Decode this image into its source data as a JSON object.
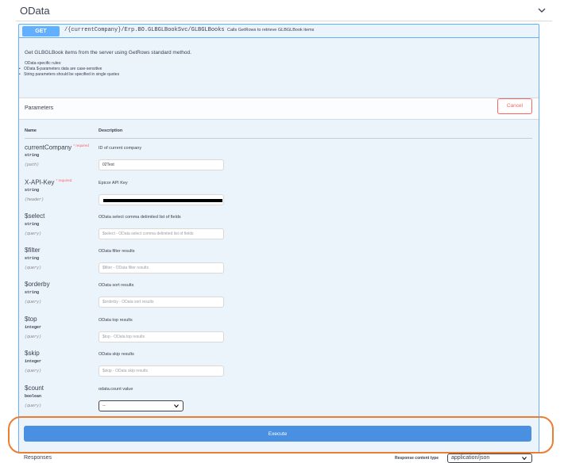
{
  "section": {
    "title": "OData"
  },
  "operation": {
    "method": "GET",
    "path": "/{currentCompany}/Erp.BO.GLBGLBookSvc/GLBGLBooks",
    "summary": "Calls GetRows to retrieve GLBGLBook items",
    "description": "Get GLBGLBook items from the server using GetRows standard method.",
    "rules_heading": "OData-specific rules:",
    "rules": [
      "OData $-parameters data are case-sensitive",
      "String parameters should be specified in single quotes"
    ]
  },
  "parameters": {
    "title": "Parameters",
    "cancel_label": "Cancel",
    "col_name": "Name",
    "col_description": "Description",
    "required_label": "* required",
    "items": [
      {
        "name": "currentCompany",
        "required": true,
        "type": "string",
        "in": "(path)",
        "description": "ID of current company",
        "value": "02Test",
        "placeholder": ""
      },
      {
        "name": "X-API-Key",
        "required": true,
        "type": "string",
        "in": "(header)",
        "description": "Epicor API Key",
        "value": "",
        "placeholder": "",
        "redacted": true
      },
      {
        "name": "$select",
        "required": false,
        "type": "string",
        "in": "(query)",
        "description": "OData select comma delimited list of fields",
        "value": "",
        "placeholder": "$select - OData select comma delimited list of fields"
      },
      {
        "name": "$filter",
        "required": false,
        "type": "string",
        "in": "(query)",
        "description": "OData filter results",
        "value": "",
        "placeholder": "$filter - OData filter results"
      },
      {
        "name": "$orderby",
        "required": false,
        "type": "string",
        "in": "(query)",
        "description": "OData sort results",
        "value": "",
        "placeholder": "$orderby - OData sort results"
      },
      {
        "name": "$top",
        "required": false,
        "type": "integer",
        "in": "(query)",
        "description": "OData top results",
        "value": "",
        "placeholder": "$top - OData top results"
      },
      {
        "name": "$skip",
        "required": false,
        "type": "integer",
        "in": "(query)",
        "description": "OData skip results",
        "value": "",
        "placeholder": "$skip - OData skip results"
      },
      {
        "name": "$count",
        "required": false,
        "type": "boolean",
        "in": "(query)",
        "description": "odata.count value",
        "select_value": "--"
      }
    ]
  },
  "execute_label": "Execute",
  "responses": {
    "title": "Responses",
    "content_type_label": "Response content type",
    "content_type_value": "application/json"
  },
  "colors": {
    "get": "#61affe",
    "execute": "#4990e2",
    "cancel": "#ff6060",
    "highlight": "#ed7d31"
  }
}
